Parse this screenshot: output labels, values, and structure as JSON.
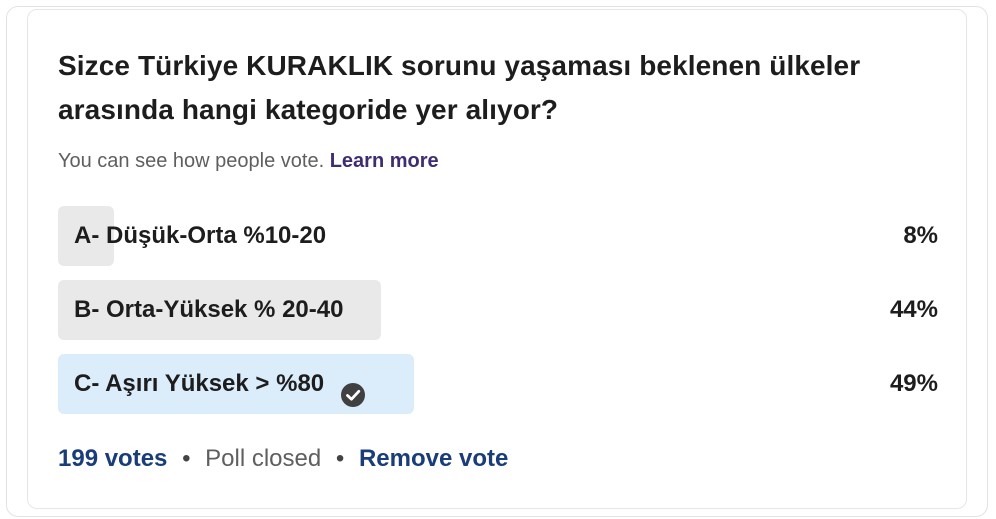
{
  "poll": {
    "question": "Sizce Türkiye KURAKLIK sorunu yaşaması beklenen ülkeler arasında hangi kategoride yer alıyor?",
    "hint_text": "You can see how people vote.",
    "learn_more": "Learn more",
    "options": [
      {
        "label": "A- Düşük-Orta %10-20",
        "percent_text": "8%",
        "fill": 0.08,
        "selected": false
      },
      {
        "label": "B- Orta-Yüksek % 20-40",
        "percent_text": "44%",
        "fill": 0.44,
        "selected": false
      },
      {
        "label": "C- Aşırı Yüksek > %80",
        "percent_text": "49%",
        "fill": 0.49,
        "selected": true
      }
    ],
    "votes": "199 votes",
    "separator": "•",
    "status": "Poll closed",
    "remove_vote": "Remove vote"
  },
  "icons": {
    "selected_option": "check-circle-icon"
  },
  "colors": {
    "bar_default": "#e9e9e9",
    "bar_selected": "#dbecfb",
    "link": "#1a3d7a",
    "learn_more": "#3f2d74"
  }
}
